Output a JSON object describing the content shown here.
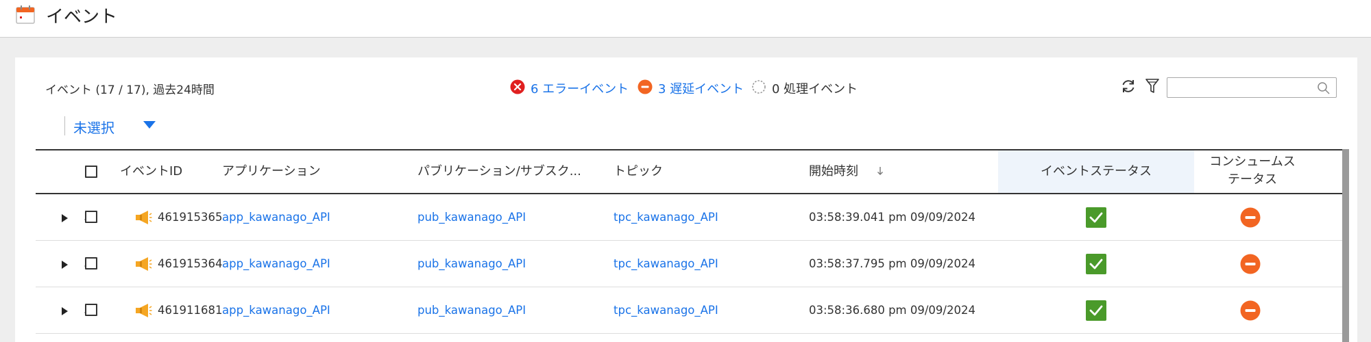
{
  "header": {
    "title": "イベント",
    "icon": "calendar-icon"
  },
  "toolbar": {
    "count_label": "イベント (17 / 17), 過去24時間",
    "error_summary": "6 エラーイベント",
    "delay_summary": "3 遅延イベント",
    "processing_summary": "0 処理イベント",
    "search_placeholder": "",
    "selection_label": "未選択"
  },
  "table": {
    "columns": {
      "event_id": "イベントID",
      "application": "アプリケーション",
      "publication": "パブリケーション/サブスク...",
      "topic": "トピック",
      "start_time": "開始時刻",
      "event_status": "イベントステータス",
      "consume_status": "コンシュームステータス"
    },
    "sort_column": "開始時刻",
    "sort_direction": "descending",
    "rows": [
      {
        "event_id": "461915365",
        "application": "app_kawanago_API",
        "publication": "pub_kawanago_API",
        "topic": "tpc_kawanago_API",
        "start_time": "03:58:39.041 pm 09/09/2024",
        "event_status": "success",
        "consume_status": "delayed"
      },
      {
        "event_id": "461915364",
        "application": "app_kawanago_API",
        "publication": "pub_kawanago_API",
        "topic": "tpc_kawanago_API",
        "start_time": "03:58:37.795 pm 09/09/2024",
        "event_status": "success",
        "consume_status": "delayed"
      },
      {
        "event_id": "461911681",
        "application": "app_kawanago_API",
        "publication": "pub_kawanago_API",
        "topic": "tpc_kawanago_API",
        "start_time": "03:58:36.680 pm 09/09/2024",
        "event_status": "success",
        "consume_status": "delayed"
      }
    ]
  },
  "colors": {
    "link": "#1a73e8",
    "error": "#e02020",
    "delay": "#f26522",
    "success": "#4a9a2a",
    "header_highlight": "#eef4fb",
    "event_icon": "#f5a623"
  }
}
